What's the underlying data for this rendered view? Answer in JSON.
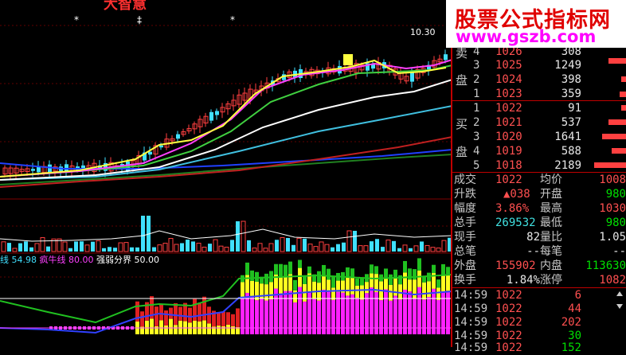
{
  "app": {
    "logo_text": "大智慧"
  },
  "watermark": {
    "line1": "股票公式指标网",
    "line2": "www.gszb.com"
  },
  "chart": {
    "price_label": "10.30",
    "markers": [
      "*",
      "‡",
      "*"
    ],
    "indicator_labels": [
      {
        "text": "线",
        "color": "#40e0ff"
      },
      {
        "text": "54.98",
        "color": "#40e0ff"
      },
      {
        "text": "疯牛线",
        "color": "#ff40ff"
      },
      {
        "text": "80.00",
        "color": "#ff40ff"
      },
      {
        "text": "强弱分界",
        "color": "#ffffff"
      },
      {
        "text": "50.00",
        "color": "#ffffff"
      }
    ]
  },
  "order_book": {
    "sell_label_top": "卖",
    "sell_label_bottom": "盘",
    "buy_label_top": "买",
    "buy_label_bottom": "盘",
    "sell": [
      {
        "level": "4",
        "price": "1026",
        "vol": "308"
      },
      {
        "level": "3",
        "price": "1025",
        "vol": "1249"
      },
      {
        "level": "2",
        "price": "1024",
        "vol": "398"
      },
      {
        "level": "1",
        "price": "1023",
        "vol": "359"
      }
    ],
    "buy": [
      {
        "level": "1",
        "price": "1022",
        "vol": "91"
      },
      {
        "level": "2",
        "price": "1021",
        "vol": "537"
      },
      {
        "level": "3",
        "price": "1020",
        "vol": "1641"
      },
      {
        "level": "4",
        "price": "1019",
        "vol": "588"
      },
      {
        "level": "5",
        "price": "1018",
        "vol": "2189"
      }
    ]
  },
  "quote": [
    {
      "l1": "成交",
      "v1": "1022",
      "l2": "均价",
      "v2": "1008"
    },
    {
      "l1": "升跌",
      "v1": "▲038",
      "l2": "开盘",
      "v2": "980"
    },
    {
      "l1": "幅度",
      "v1": "3.86%",
      "l2": "最高",
      "v2": "1030"
    },
    {
      "l1": "总手",
      "v1": "269532",
      "l2": "最低",
      "v2": "980"
    },
    {
      "l1": "现手",
      "v1": "82",
      "l2": "量比",
      "v2": "1.05"
    },
    {
      "l1": "总笔",
      "v1": "--",
      "l2": "每笔",
      "v2": "--"
    },
    {
      "l1": "外盘",
      "v1": "155902",
      "l2": "内盘",
      "v2": "113630"
    },
    {
      "l1": "换手",
      "v1": "1.84%",
      "l2": "涨停",
      "v2": "1082"
    }
  ],
  "ticks": [
    {
      "time": "14:59",
      "price": "1022",
      "vol": "6"
    },
    {
      "time": "14:59",
      "price": "1022",
      "vol": "44"
    },
    {
      "time": "14:59",
      "price": "1022",
      "vol": "202"
    },
    {
      "time": "14:59",
      "price": "1022",
      "vol": "30"
    },
    {
      "time": "14:59",
      "price": "1022",
      "vol": "152"
    }
  ]
}
